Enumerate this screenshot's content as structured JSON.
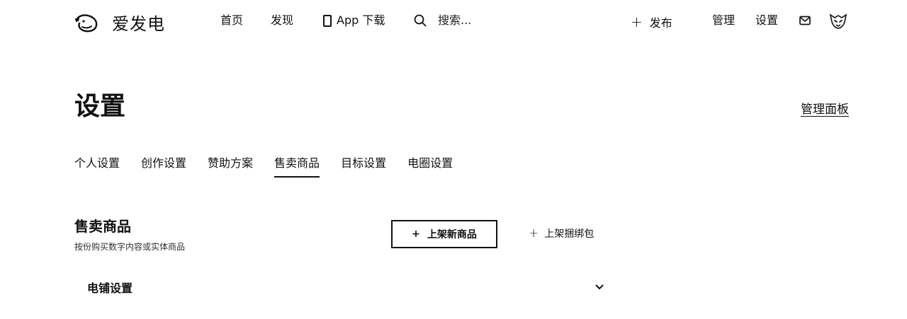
{
  "header": {
    "brand_name": "爱发电",
    "nav": {
      "home": "首页",
      "discover": "发现",
      "app_download": "App 下载"
    },
    "search": {
      "placeholder": "搜索..."
    },
    "publish_label": "发布",
    "manage_label": "管理",
    "settings_label": "设置"
  },
  "page": {
    "title": "设置",
    "admin_panel_link": "管理面板"
  },
  "tabs": [
    {
      "label": "个人设置",
      "active": false
    },
    {
      "label": "创作设置",
      "active": false
    },
    {
      "label": "赞助方案",
      "active": false
    },
    {
      "label": "售卖商品",
      "active": true
    },
    {
      "label": "目标设置",
      "active": false
    },
    {
      "label": "电圈设置",
      "active": false
    }
  ],
  "section": {
    "title": "售卖商品",
    "subtitle": "按份购买数字内容或实体商品",
    "add_product_label": "上架新商品",
    "add_bundle_label": "上架捆绑包",
    "store_settings_label": "电铺设置"
  }
}
